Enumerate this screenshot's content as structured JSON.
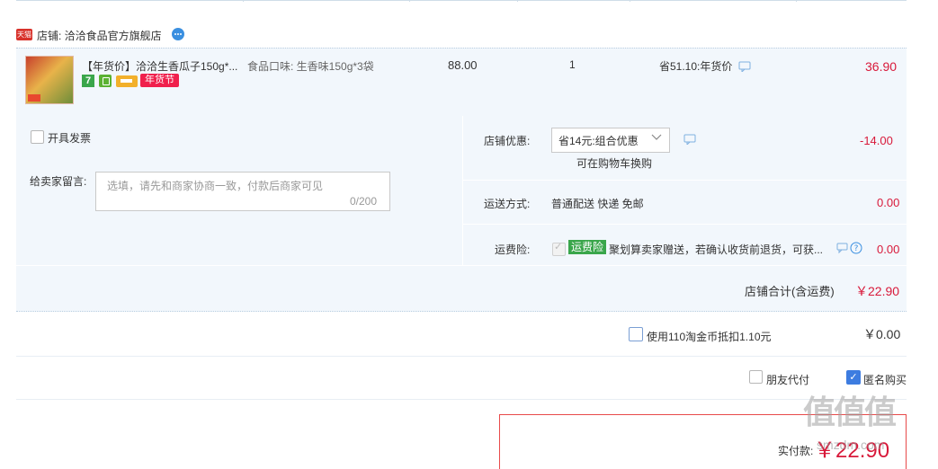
{
  "shop": {
    "tmall_badge": "天猫",
    "name_label": "店铺: 洽洽食品官方旗舰店"
  },
  "item": {
    "title": "【年货价】洽洽生香瓜子150g*...",
    "sku": "食品口味: 生香味150g*3袋",
    "price": "88.00",
    "quantity": "1",
    "discount_note": "省51.10:年货价",
    "subtotal": "36.90",
    "badges": {
      "seven": "7",
      "nianhuo": "年货节"
    }
  },
  "options": {
    "invoice_label": "开具发票",
    "message_label": "给卖家留言:",
    "message_placeholder": "选填，请先和商家协商一致，付款后商家可见",
    "message_count": "0/200",
    "shop_discount_label": "店铺优惠:",
    "shop_discount_selected": "省14元:组合优惠",
    "shop_discount_note": "可在购物车换购",
    "shop_discount_amount": "-14.00",
    "shipping_label": "运送方式:",
    "shipping_method": "普通配送 快递 免邮",
    "shipping_amount": "0.00",
    "insurance_label": "运费险:",
    "insurance_badge": "运费险",
    "insurance_text": "聚划算卖家赠送，若确认收货前退货，可获...",
    "insurance_amount": "0.00"
  },
  "shop_total": {
    "label": "店铺合计(含运费)",
    "value": "￥22.90"
  },
  "coins": {
    "label": "使用110淘金币抵扣1.10元",
    "amount": "￥0.00"
  },
  "pay_options": {
    "friend_pay": "朋友代付",
    "anonymous": "匿名购买",
    "anonymous_checked": "✓"
  },
  "final": {
    "label": "实付款:",
    "amount": "￥22.90"
  },
  "watermark": {
    "text": "值值值",
    "url": "smzdm.com"
  },
  "colors": {
    "price_red": "#d8193a",
    "row_bg": "#f2f7fc",
    "checkbox_blue": "#3d7ce0",
    "green_badge": "#3aa64b"
  }
}
